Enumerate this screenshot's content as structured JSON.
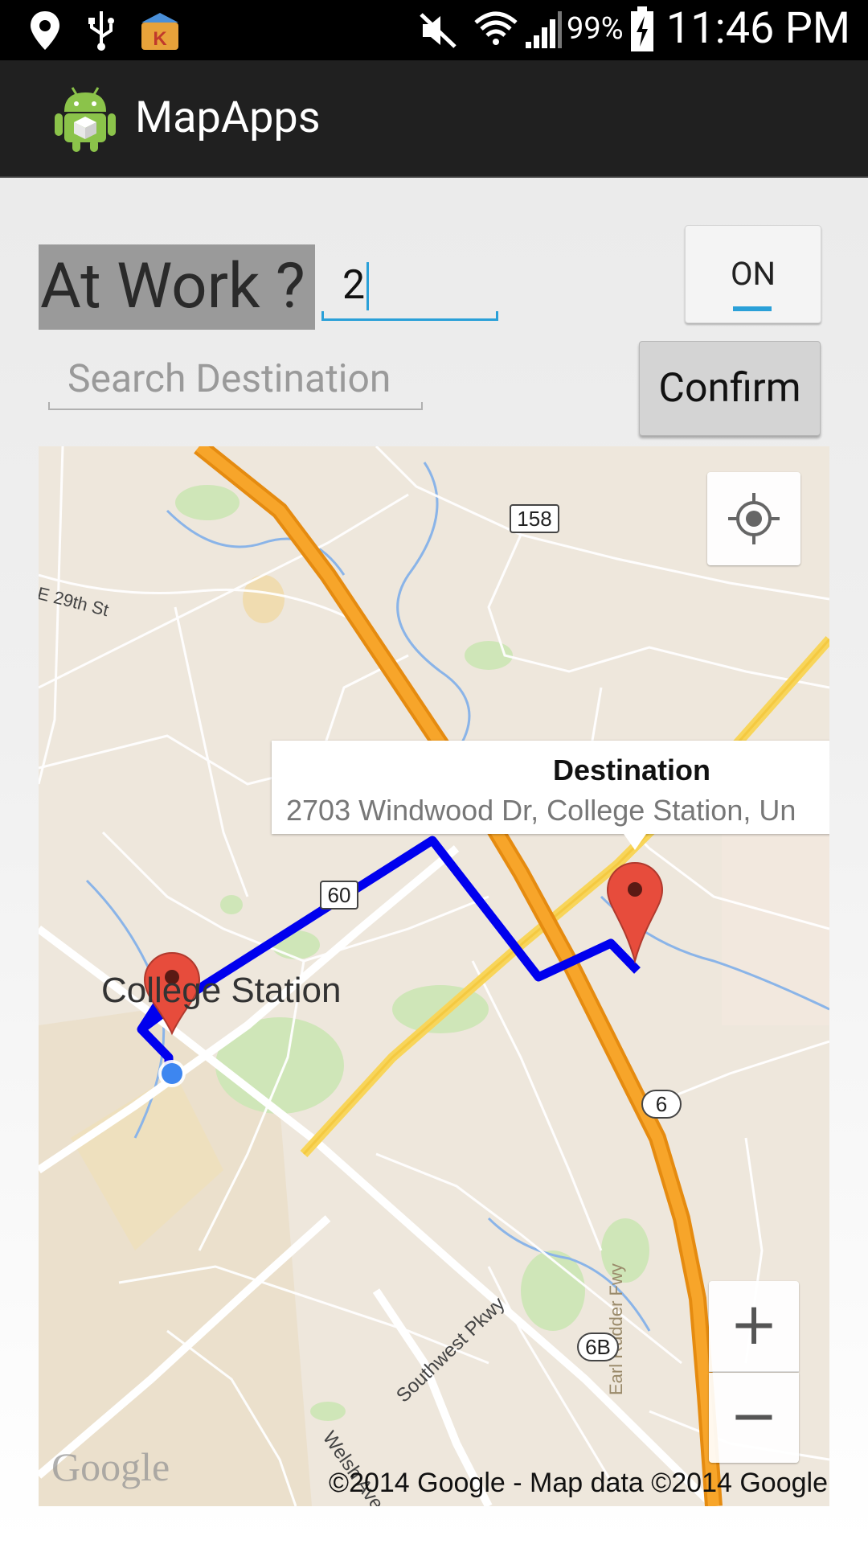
{
  "status_bar": {
    "battery_percent": "99%",
    "time": "11:46 PM",
    "icons": [
      "location-pin-icon",
      "usb-icon",
      "kingroot-app-icon",
      "mute-icon",
      "wifi-icon",
      "signal-icon",
      "battery-charging-icon"
    ]
  },
  "action_bar": {
    "title": "MapApps",
    "icon": "android-app-icon"
  },
  "form": {
    "at_work_label": "At Work ?",
    "number_value": "2",
    "toggle_label": "ON",
    "search_placeholder": "Search Destination",
    "confirm_label": "Confirm"
  },
  "map": {
    "info_window": {
      "title": "Destination",
      "address": "2703 Windwood Dr, College Station, Un"
    },
    "labels": {
      "college_station": "College Station",
      "e29th": "E 29th St",
      "southwest": "Southwest Pkwy",
      "welsh": "Welsh Ave",
      "earl": "Earl Rudder Fwy"
    },
    "shields": {
      "r158": "158",
      "r60": "60",
      "r6": "6",
      "r6b": "6B"
    },
    "zoom_in": "+",
    "zoom_out": "−",
    "google_logo": "Google",
    "copyright": "©2014 Google - Map data ©2014 Google",
    "colors": {
      "route": "#0000ee",
      "highway": "#f3a21e",
      "marker": "#e74c3c",
      "accent": "#2aa0d8"
    }
  }
}
